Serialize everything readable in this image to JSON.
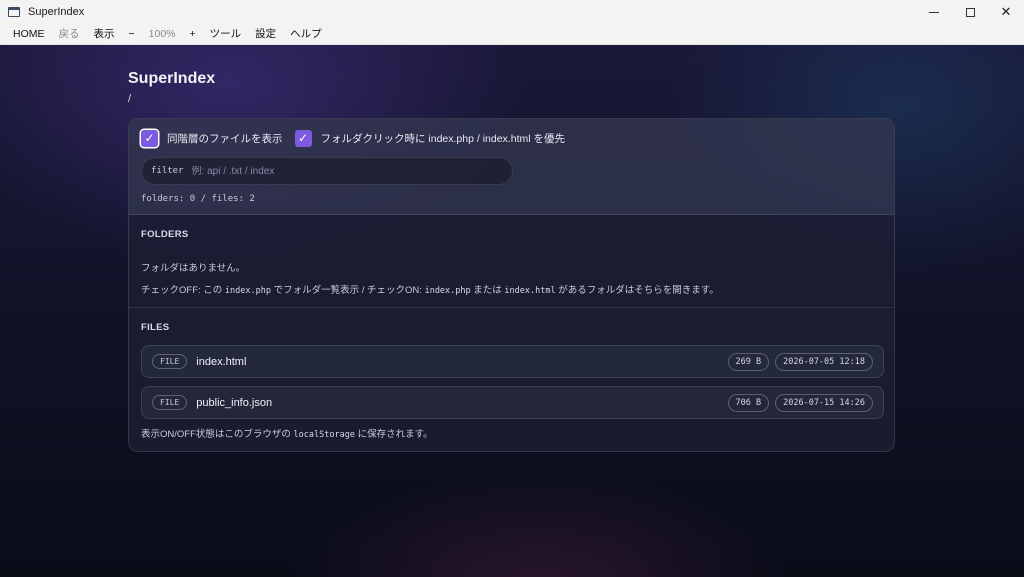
{
  "window": {
    "title": "SuperIndex"
  },
  "menu": {
    "items": [
      {
        "label": "HOME",
        "disabled": false
      },
      {
        "label": "戻る",
        "disabled": true
      },
      {
        "label": "表示",
        "disabled": false
      },
      {
        "label": "−",
        "disabled": false
      },
      {
        "label": "100%",
        "disabled": true
      },
      {
        "label": "+",
        "disabled": false
      },
      {
        "label": "ツール",
        "disabled": false
      },
      {
        "label": "設定",
        "disabled": false
      },
      {
        "label": "ヘルプ",
        "disabled": false
      }
    ]
  },
  "page": {
    "title": "SuperIndex",
    "path": "/"
  },
  "options": {
    "show_same_level": {
      "label": "同階層のファイルを表示",
      "checked": true
    },
    "prefer_index": {
      "label": "フォルダクリック時に index.php / index.html を優先",
      "checked": true
    }
  },
  "filter": {
    "tag": "filter",
    "placeholder": "例: api / .txt / index",
    "value": ""
  },
  "counts": "folders: 0 / files: 2",
  "folders": {
    "heading": "FOLDERS",
    "empty_text": "フォルダはありません。",
    "note": {
      "p1": "チェックOFF: この ",
      "c1": "index.php",
      "p2": " でフォルダ一覧表示 / チェックON: ",
      "c2": "index.php",
      "p3": " または ",
      "c3": "index.html",
      "p4": " があるフォルダはそちらを開きます。"
    }
  },
  "files": {
    "heading": "FILES",
    "items": [
      {
        "type": "FILE",
        "name": "index.html",
        "size": "269 B",
        "date": "2026-07-05 12:18"
      },
      {
        "type": "FILE",
        "name": "public_info.json",
        "size": "706 B",
        "date": "2026-07-15 14:26"
      }
    ]
  },
  "footer": {
    "p1": "表示ON/OFF状態はこのブラウザの ",
    "code": "localStorage",
    "p2": " に保存されます。"
  }
}
